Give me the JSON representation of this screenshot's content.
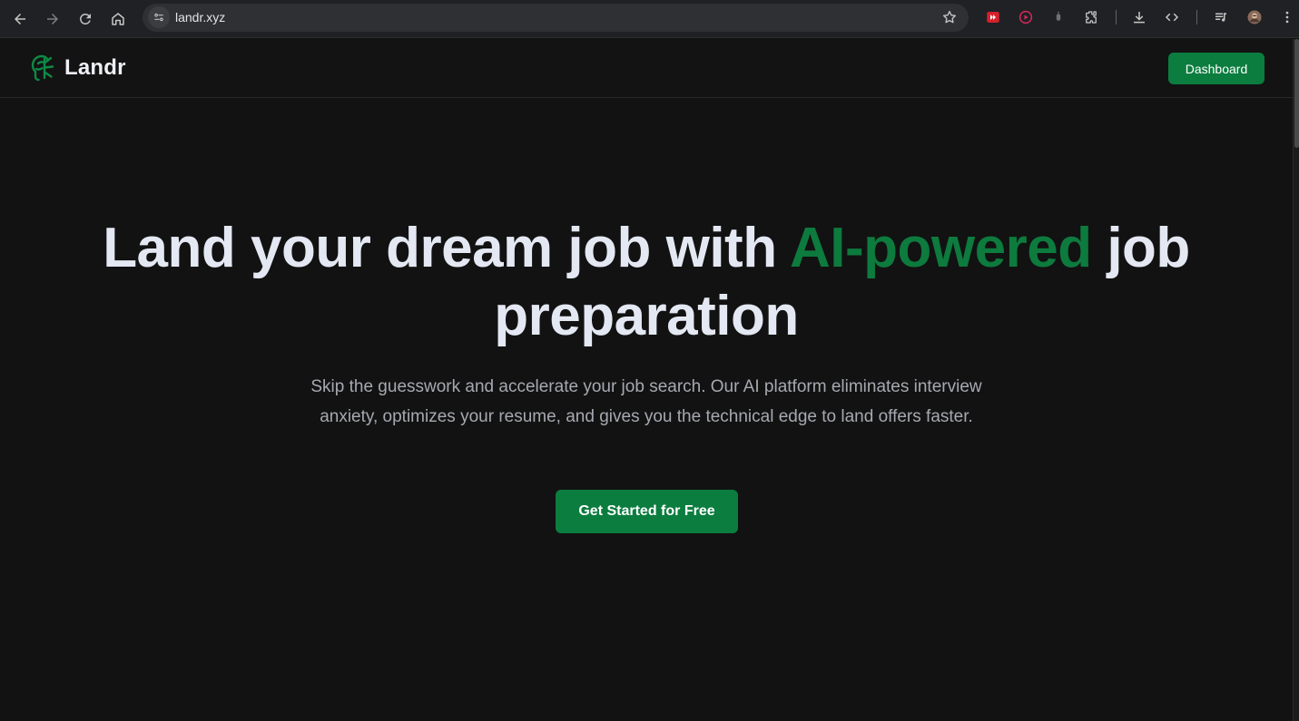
{
  "browser": {
    "url": "landr.xyz"
  },
  "header": {
    "brand_name": "Landr",
    "dashboard_label": "Dashboard"
  },
  "hero": {
    "title_before": "Land your dream job with ",
    "title_accent": "AI-powered",
    "title_after": " job preparation",
    "subtitle": "Skip the guesswork and accelerate your job search. Our AI platform eliminates interview anxiety, optimizes your resume, and gives you the technical edge to land offers faster.",
    "cta_label": "Get Started for Free"
  },
  "colors": {
    "background": "#121212",
    "accent": "#0b7d3f",
    "title_text": "#e4e8f3",
    "body_text": "#a6a9b0"
  },
  "icons": {
    "browser": [
      "back-icon",
      "forward-icon",
      "reload-icon",
      "home-icon",
      "site-info-icon",
      "bookmark-star-icon",
      "extension-red-icon",
      "extension-play-icon",
      "extension-gray-icon",
      "puzzle-icon",
      "download-icon",
      "code-icon",
      "media-icon",
      "profile-avatar",
      "kebab-menu-icon"
    ],
    "brand": "leaf-brain-logo-icon"
  }
}
